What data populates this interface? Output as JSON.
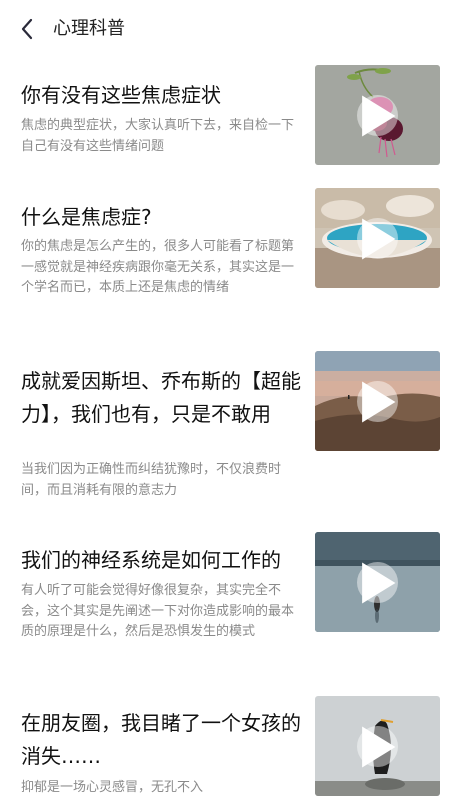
{
  "header": {
    "title": "心理科普"
  },
  "articles": [
    {
      "title": "你有没有这些焦虑症状",
      "desc": "焦虑的典型症状，大家认真听下去，来自检一下自己有没有这些情绪问题",
      "thumb": "fuchsia-flower"
    },
    {
      "title": "什么是焦虑症?",
      "desc": "你的焦虑是怎么产生的，很多人可能看了标题第一感觉就是神经疾病跟你毫无关系，其实这是一个学名而已，本质上还是焦虑的情绪",
      "thumb": "water-bowl"
    },
    {
      "title": "成就爱因斯坦、乔布斯的【超能力】，我们也有，只是不敢用",
      "desc": "当我们因为正确性而纠结犹豫时，不仅浪费时间，而且消耗有限的意志力",
      "thumb": "desert-dune"
    },
    {
      "title": "我们的神经系统是如何工作的",
      "desc": "有人听了可能会觉得好像很复杂，其实完全不会，这个其实是先阐述一下对你造成影响的最本质的原理是什么，然后是恐惧发生的模式",
      "thumb": "lake-bird"
    },
    {
      "title": "在朋友圈，我目睹了一个女孩的消失……",
      "desc": "抑郁是一场心灵感冒，无孔不入",
      "thumb": "cormorant"
    }
  ]
}
